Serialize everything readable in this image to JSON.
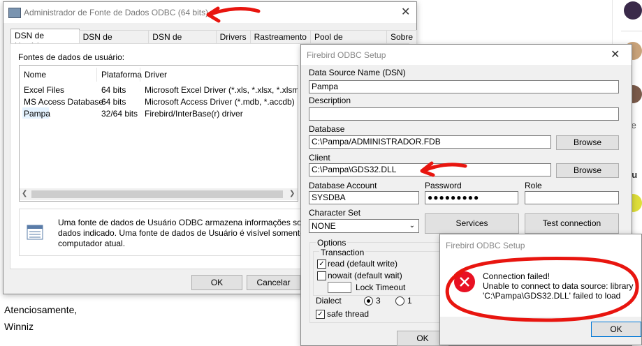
{
  "odbc": {
    "title": "Administrador de Fonte de Dados ODBC (64 bits)",
    "tabs": [
      "DSN de Usuário",
      "DSN de Sistema",
      "DSN de Arquivo",
      "Drivers",
      "Rastreamento",
      "Pool de Conexões",
      "Sobre"
    ],
    "list_label": "Fontes de dados de usuário:",
    "columns": [
      "Nome",
      "Plataforma",
      "Driver"
    ],
    "rows": [
      [
        "Excel Files",
        "64 bits",
        "Microsoft Excel Driver (*.xls, *.xlsx, *.xlsm, *.xls"
      ],
      [
        "MS Access Database",
        "64 bits",
        "Microsoft Access Driver (*.mdb, *.accdb)"
      ],
      [
        "Pampa",
        "32/64 bits",
        "Firebird/InterBase(r) driver"
      ]
    ],
    "info_line1": "Uma fonte de dados de Usuário ODBC armazena informações sobre como",
    "info_line2": "dados indicado. Uma fonte de dados de Usuário é visível somente a você",
    "info_line3": "computador atual.",
    "ok": "OK",
    "cancel": "Cancelar"
  },
  "setup": {
    "title": "Firebird ODBC Setup",
    "dsn_label": "Data Source Name (DSN)",
    "dsn_value": "Pampa",
    "description_label": "Description",
    "description_value": "",
    "database_label": "Database",
    "database_value": "C:\\Pampa/ADMINISTRADOR.FDB",
    "browse": "Browse",
    "client_label": "Client",
    "client_value": "C:\\Pampa\\GDS32.DLL",
    "account_label": "Database Account",
    "account_value": "SYSDBA",
    "password_label": "Password",
    "password_value": "●●●●●●●●●",
    "role_label": "Role",
    "role_value": "",
    "charset_label": "Character Set",
    "charset_value": "NONE",
    "services": "Services",
    "test_connection": "Test connection",
    "options_label": "Options",
    "transaction_label": "Transaction",
    "read_label": "read (default write)",
    "nowait_label": "nowait (default wait)",
    "lock_timeout_label": "Lock Timeout",
    "dialect_label": "Dialect",
    "dialect_3": "3",
    "dialect_1": "1",
    "safe_thread_label": "safe thread",
    "ok": "OK"
  },
  "error": {
    "title": "Firebird ODBC Setup",
    "line1": "Connection failed!",
    "line2": "Unable to connect to data source: library",
    "line3": "'C:\\Pampa\\GDS32.DLL' failed to load",
    "ok": "OK"
  },
  "email": {
    "line1": "Atenciosamente,",
    "line2": "Winniz"
  },
  "right_strip": {
    "t1": "Se",
    "t2": "Ju"
  },
  "colors": {
    "annotation_red": "#e8150f",
    "error_icon": "#e81123",
    "highlight": "#cce8ff"
  }
}
